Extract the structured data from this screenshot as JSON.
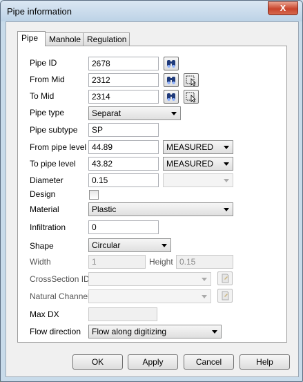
{
  "window": {
    "title": "Pipe information",
    "close_label": "X"
  },
  "tabs": [
    {
      "label": "Pipe",
      "active": true
    },
    {
      "label": "Manhole",
      "active": false
    },
    {
      "label": "Regulation",
      "active": false
    }
  ],
  "fields": {
    "pipe_id": {
      "label": "Pipe ID",
      "value": "2678"
    },
    "from_mid": {
      "label": "From Mid",
      "value": "2312"
    },
    "to_mid": {
      "label": "To Mid",
      "value": "2314"
    },
    "pipe_type": {
      "label": "Pipe type",
      "value": "Separat"
    },
    "pipe_subtype": {
      "label": "Pipe subtype",
      "value": "SP"
    },
    "from_pipe_level": {
      "label": "From pipe level",
      "value": "44.89",
      "method": "MEASURED"
    },
    "to_pipe_level": {
      "label": "To pipe level",
      "value": "43.82",
      "method": "MEASURED"
    },
    "diameter": {
      "label": "Diameter",
      "value": "0.15",
      "unit": ""
    },
    "design": {
      "label": "Design",
      "checked": false
    },
    "material": {
      "label": "Material",
      "value": "Plastic"
    },
    "infiltration": {
      "label": "Infiltration",
      "value": "0"
    },
    "shape": {
      "label": "Shape",
      "value": "Circular"
    },
    "width": {
      "label": "Width",
      "value": "1"
    },
    "height": {
      "label": "Height",
      "value": "0.15"
    },
    "crosssection_id": {
      "label": "CrossSection ID",
      "value": ""
    },
    "natural_channel": {
      "label": "Natural Channel",
      "value": ""
    },
    "max_dx": {
      "label": "Max DX",
      "value": ""
    },
    "flow_direction": {
      "label": "Flow direction",
      "value": "Flow along digitizing"
    }
  },
  "buttons": {
    "ok": "OK",
    "apply": "Apply",
    "cancel": "Cancel",
    "help": "Help"
  },
  "icons": {
    "find": "binoculars-icon",
    "pick": "pick-pointer-icon",
    "browse": "browse-page-icon"
  }
}
